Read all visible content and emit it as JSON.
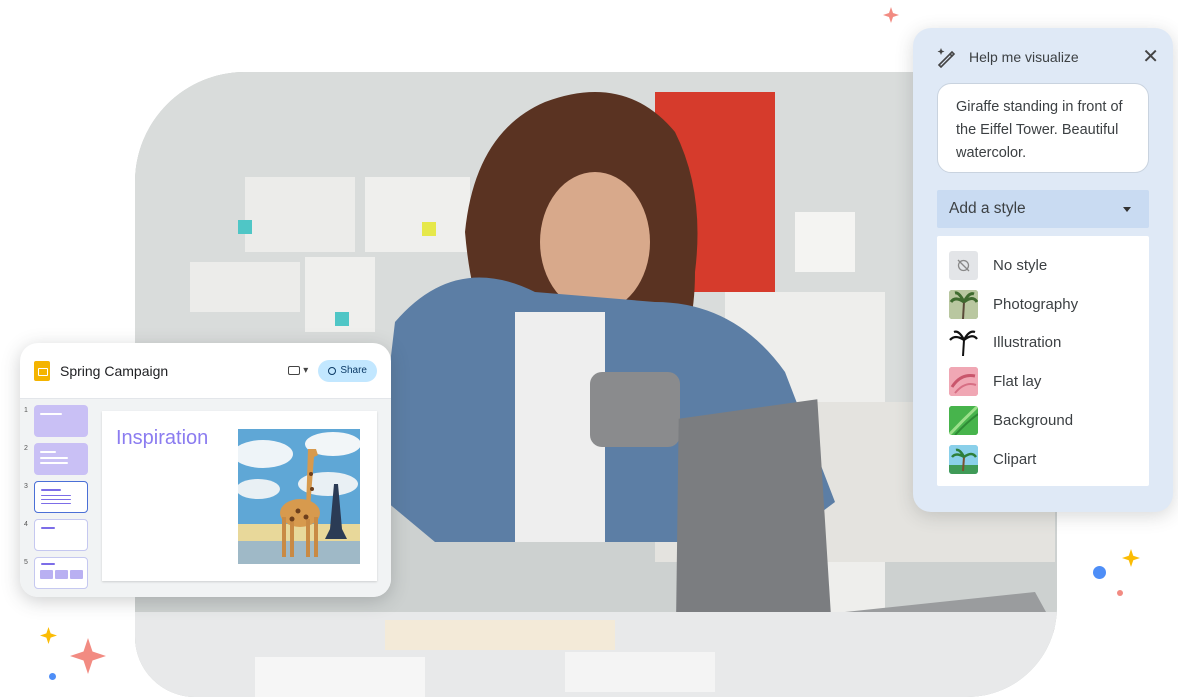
{
  "slides_app": {
    "title": "Spring Campaign",
    "share_label": "Share",
    "meet_label": "▾",
    "thumbnail_numbers": [
      "1",
      "2",
      "3",
      "4",
      "5"
    ],
    "slide_heading": "Inspiration"
  },
  "visualize_panel": {
    "title": "Help me visualize",
    "close_label": "✕",
    "prompt_text": "Giraffe standing in front of the Eiffel Tower. Beautiful watercolor.",
    "style_select_label": "Add a style",
    "styles": [
      {
        "label": "No style",
        "icon": "no-style-icon"
      },
      {
        "label": "Photography",
        "icon": "photography-icon"
      },
      {
        "label": "Illustration",
        "icon": "illustration-icon"
      },
      {
        "label": "Flat lay",
        "icon": "flat-lay-icon"
      },
      {
        "label": "Background",
        "icon": "background-icon"
      },
      {
        "label": "Clipart",
        "icon": "clipart-icon"
      }
    ]
  },
  "colors": {
    "panel_bg": "#dfe9f6",
    "select_bg": "#c9dbf2",
    "share_bg": "#c2e7ff",
    "slide_heading": "#8b7cf0",
    "slides_icon": "#f4b400"
  }
}
